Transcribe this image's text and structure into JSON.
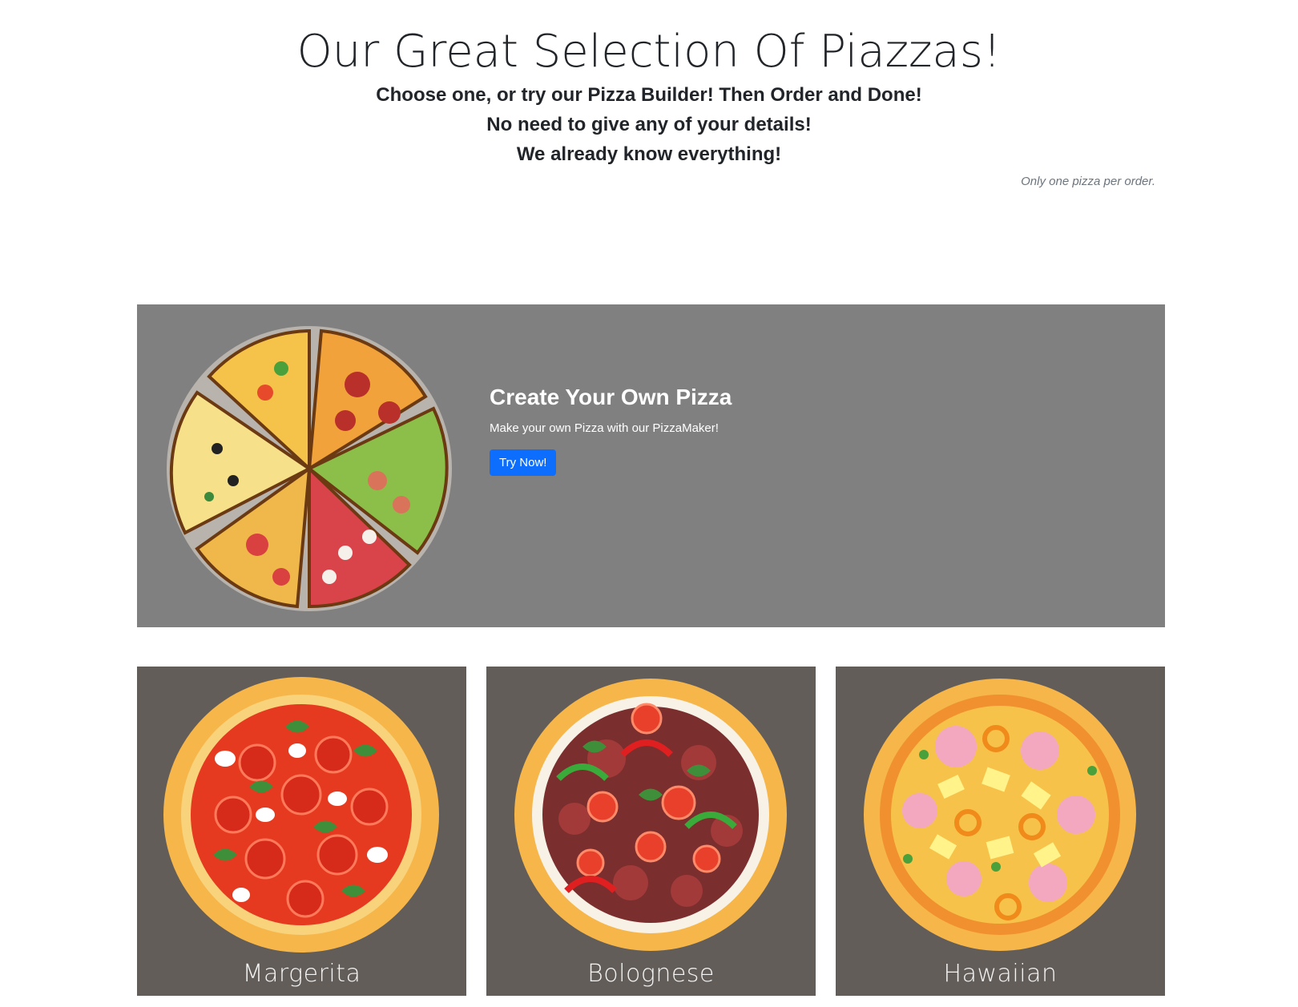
{
  "header": {
    "title": "Our Great Selection Of Piazzas!",
    "subtitle_lines": [
      "Choose one, or try our Pizza Builder! Then Order and Done!",
      "No need to give any of your details!",
      "We already know everything!"
    ],
    "note": "Only one pizza per order."
  },
  "builder": {
    "title": "Create Your Own Pizza",
    "description": "Make your own Pizza with our PizzaMaker!",
    "button_label": "Try Now!",
    "background": "#808080",
    "button_color": "#0d6efd"
  },
  "pizzas": [
    {
      "name": "Margerita",
      "icon": "margherita-pizza-image"
    },
    {
      "name": "Bolognese",
      "icon": "bolognese-pizza-image"
    },
    {
      "name": "Hawaiian",
      "icon": "hawaiian-pizza-image"
    }
  ],
  "colors": {
    "card_background": "#625d59",
    "crust": "#f0a43a",
    "sauce": "#e53a1f"
  }
}
